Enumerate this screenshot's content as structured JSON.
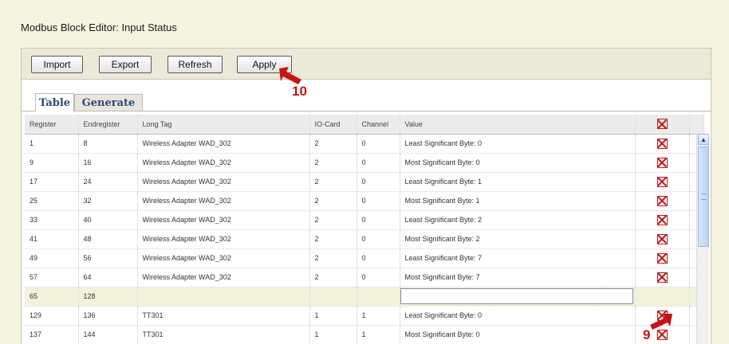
{
  "page_title": "Modbus Block Editor: Input Status",
  "toolbar": {
    "import_label": "Import",
    "export_label": "Export",
    "refresh_label": "Refresh",
    "apply_label": "Apply"
  },
  "tabs": [
    {
      "label": "Table",
      "active": true
    },
    {
      "label": "Generate",
      "active": false
    }
  ],
  "table": {
    "headers": [
      "Register",
      "Endregister",
      "Long Tag",
      "IO-Card",
      "Channel",
      "Value"
    ],
    "delete_icon": "red-x-box-icon",
    "rows": [
      {
        "register": "1",
        "endregister": "8",
        "long_tag": "Wireless Adapter WAD_302",
        "io_card": "2",
        "channel": "0",
        "value": "Least Significant Byte: 0"
      },
      {
        "register": "9",
        "endregister": "16",
        "long_tag": "Wireless Adapter WAD_302",
        "io_card": "2",
        "channel": "0",
        "value": "Most Significant Byte: 0"
      },
      {
        "register": "17",
        "endregister": "24",
        "long_tag": "Wireless Adapter WAD_302",
        "io_card": "2",
        "channel": "0",
        "value": "Least Significant Byte: 1"
      },
      {
        "register": "25",
        "endregister": "32",
        "long_tag": "Wireless Adapter WAD_302",
        "io_card": "2",
        "channel": "0",
        "value": "Most Significant Byte: 1"
      },
      {
        "register": "33",
        "endregister": "40",
        "long_tag": "Wireless Adapter WAD_302",
        "io_card": "2",
        "channel": "0",
        "value": "Least Significant Byte: 2"
      },
      {
        "register": "41",
        "endregister": "48",
        "long_tag": "Wireless Adapter WAD_302",
        "io_card": "2",
        "channel": "0",
        "value": "Most Significant Byte: 2"
      },
      {
        "register": "49",
        "endregister": "56",
        "long_tag": "Wireless Adapter WAD_302",
        "io_card": "2",
        "channel": "0",
        "value": "Least Significant Byte: 7"
      },
      {
        "register": "57",
        "endregister": "64",
        "long_tag": "Wireless Adapter WAD_302",
        "io_card": "2",
        "channel": "0",
        "value": "Most Significant Byte: 7"
      },
      {
        "register": "65",
        "endregister": "128",
        "long_tag": "",
        "io_card": "",
        "channel": "",
        "value": ""
      },
      {
        "register": "129",
        "endregister": "136",
        "long_tag": "TT301",
        "io_card": "1",
        "channel": "1",
        "value": "Least Significant Byte: 0"
      },
      {
        "register": "137",
        "endregister": "144",
        "long_tag": "TT301",
        "io_card": "1",
        "channel": "1",
        "value": "Most Significant Byte: 0"
      }
    ]
  },
  "annotations": {
    "apply_marker": "10",
    "delete_marker": "9",
    "color": "#cc1111"
  }
}
